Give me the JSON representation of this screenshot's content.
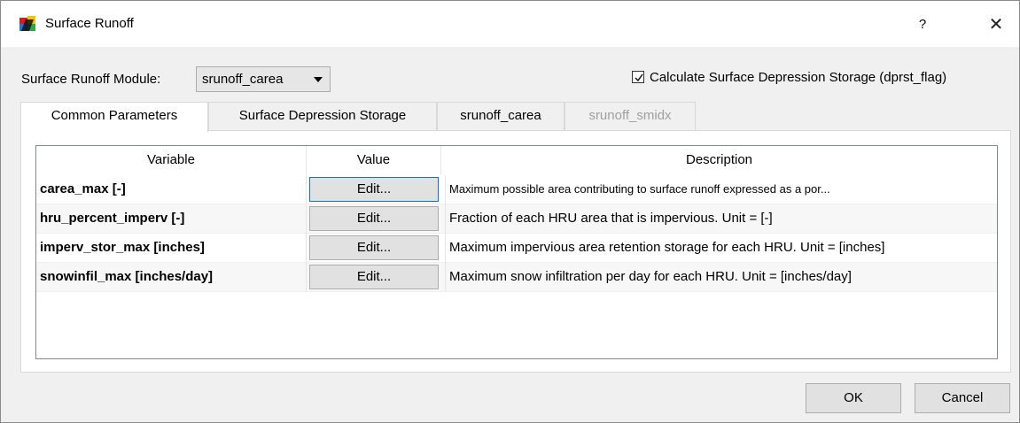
{
  "window": {
    "title": "Surface Runoff",
    "help_glyph": "?",
    "close_glyph": "✕",
    "icon": "multicolor-app-icon"
  },
  "module": {
    "label": "Surface Runoff Module:",
    "selected": "srunoff_carea"
  },
  "options": {
    "dprst_checkbox_label": "Calculate Surface Depression Storage (dprst_flag)",
    "dprst_checked": true
  },
  "tabs": [
    {
      "label": "Common Parameters",
      "active": true,
      "enabled": true
    },
    {
      "label": "Surface Depression Storage",
      "active": false,
      "enabled": true
    },
    {
      "label": "srunoff_carea",
      "active": false,
      "enabled": true
    },
    {
      "label": "srunoff_smidx",
      "active": false,
      "enabled": false
    }
  ],
  "table": {
    "headers": [
      "Variable",
      "Value",
      "Description"
    ],
    "rows": [
      {
        "variable": "carea_max [-]",
        "value": "Edit...",
        "description": "Maximum possible area contributing to surface runoff expressed as a por..."
      },
      {
        "variable": "hru_percent_imperv [-]",
        "value": "Edit...",
        "description": "Fraction of each HRU area that is impervious. Unit = [-]"
      },
      {
        "variable": "imperv_stor_max [inches]",
        "value": "Edit...",
        "description": "Maximum impervious area retention storage for each HRU. Unit = [inches]"
      },
      {
        "variable": "snowinfil_max [inches/day]",
        "value": "Edit...",
        "description": "Maximum snow infiltration per day for each HRU. Unit = [inches/day]"
      }
    ]
  },
  "buttons": {
    "ok": "OK",
    "cancel": "Cancel"
  },
  "colors": {
    "focus_border": "#0078d7",
    "window_bg": "#f0f0f0"
  }
}
